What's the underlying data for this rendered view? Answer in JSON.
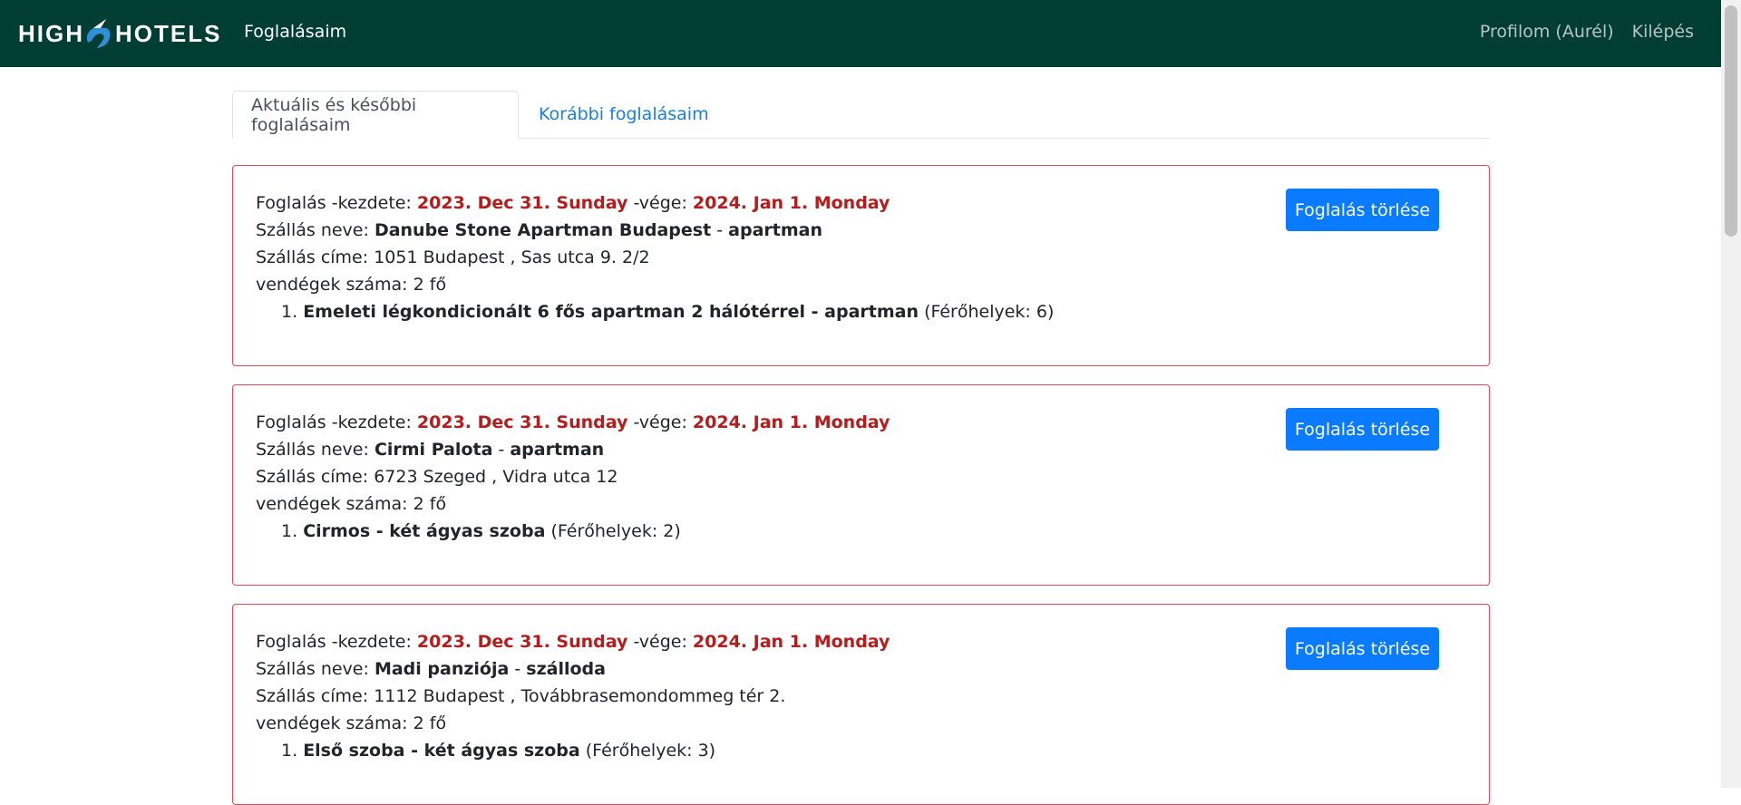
{
  "navbar": {
    "brand_left": "HIGH",
    "brand_right": "HOTELS",
    "nav_main": "Foglalásaim",
    "profile": "Profilom (Aurél)",
    "logout": "Kilépés",
    "bg_color": "#003d33"
  },
  "tabs": [
    {
      "label": "Aktuális és későbbi foglalásaim",
      "active": true
    },
    {
      "label": "Korábbi foglalásaim",
      "active": false
    }
  ],
  "labels": {
    "booking_start": "Foglalás -kezdete:",
    "booking_end": "-vége:",
    "accommodation_name": "Szállás neve:",
    "accommodation_address": "Szállás címe:",
    "guests": "vendégek száma:",
    "capacity_prefix": "(Férőhelyek:",
    "delete_button": "Foglalás törlése"
  },
  "bookings": [
    {
      "start": "2023. Dec 31. Sunday",
      "end": "2024. Jan 1. Monday",
      "name": "Danube Stone Apartman Budapest",
      "type": "apartman",
      "address": "1051 Budapest , Sas utca 9. 2/2",
      "guests": "2 fő",
      "room_number": "1.",
      "room_name": "Emeleti légkondicionált 6 fős apartman 2 hálótérrel - apartman",
      "capacity": "6)"
    },
    {
      "start": "2023. Dec 31. Sunday",
      "end": "2024. Jan 1. Monday",
      "name": "Cirmi Palota",
      "type": "apartman",
      "address": "6723 Szeged , Vidra utca 12",
      "guests": "2 fő",
      "room_number": "1.",
      "room_name": "Cirmos - két ágyas szoba",
      "capacity": "2)"
    },
    {
      "start": "2023. Dec 31. Sunday",
      "end": "2024. Jan 1. Monday",
      "name": "Madi panziója",
      "type": "szálloda",
      "address": "1112 Budapest , Továbbrasemondommeg tér 2.",
      "guests": "2 fő",
      "room_number": "1.",
      "room_name": "Első szoba - két ágyas szoba",
      "capacity": "3)"
    }
  ],
  "colors": {
    "accent_red": "#b71c1c",
    "card_border": "#e04a5a",
    "button_blue": "#0a7bff",
    "link_blue": "#1a7fe0"
  }
}
